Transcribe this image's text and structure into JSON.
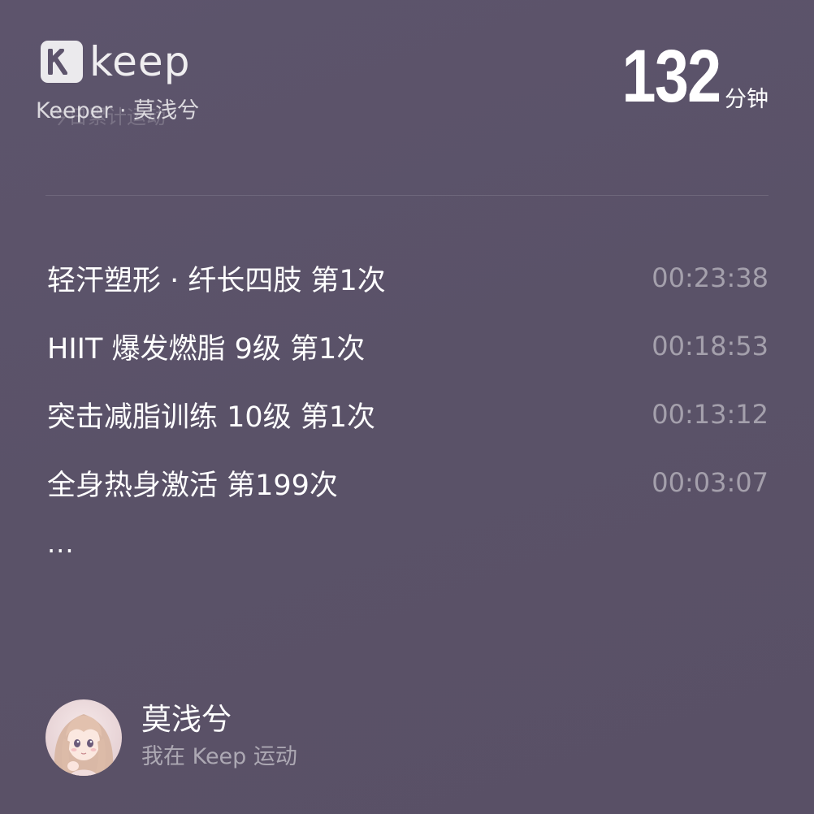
{
  "header": {
    "logo_text": "keep",
    "keeper_label": "Keeper · 莫浅兮",
    "faded_subtitle": "今日累计运动",
    "total_value": "132",
    "total_unit": "分钟"
  },
  "workouts": [
    {
      "title": "轻汗塑形 · 纤长四肢 第1次",
      "duration": "00:23:38"
    },
    {
      "title": "HIIT 爆发燃脂 9级 第1次",
      "duration": "00:18:53"
    },
    {
      "title": "突击减脂训练 10级 第1次",
      "duration": "00:13:12"
    },
    {
      "title": "全身热身激活 第199次",
      "duration": "00:03:07"
    }
  ],
  "more_indicator": "...",
  "user": {
    "name": "莫浅兮",
    "subtitle": "我在 Keep 运动",
    "avatar_icon": "avatar-anime-girl"
  },
  "colors": {
    "background": "#5a5268",
    "text_primary": "#ffffff",
    "text_muted": "#b0abb9"
  }
}
